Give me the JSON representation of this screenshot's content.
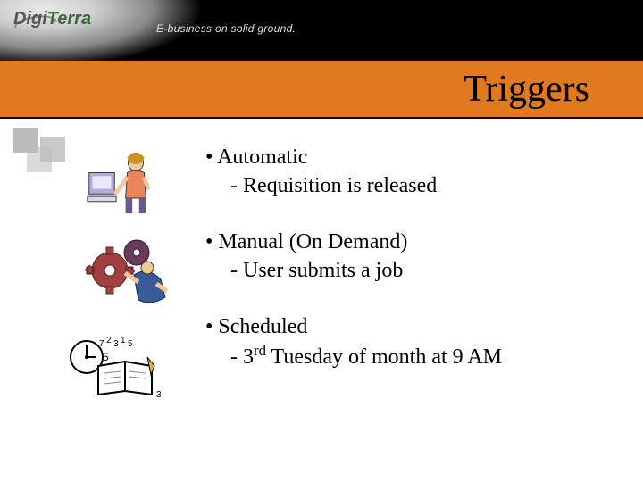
{
  "header": {
    "logo_text_a": "Digi",
    "logo_text_b": "Terra",
    "tagline": "E-business on solid ground."
  },
  "title": "Triggers",
  "items": [
    {
      "bullet": "Automatic",
      "sub": "- Requisition is released",
      "icon": "person-computer-icon"
    },
    {
      "bullet": "Manual (On Demand)",
      "sub": "- User submits a job",
      "icon": "gears-worker-icon"
    },
    {
      "bullet": "Scheduled",
      "sub_html": "- 3<sup>rd</sup> Tuesday of month at 9 AM",
      "sub": "- 3rd Tuesday of month at 9 AM",
      "icon": "clock-book-icon"
    }
  ]
}
